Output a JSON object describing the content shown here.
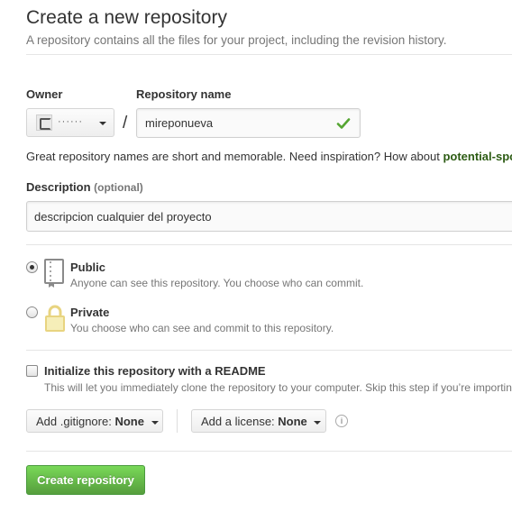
{
  "header": {
    "title": "Create a new repository",
    "subtitle": "A repository contains all the files for your project, including the revision history."
  },
  "owner": {
    "label": "Owner",
    "name": "······",
    "avatar_icon": "avatar-icon"
  },
  "repo_name": {
    "label": "Repository name",
    "value": "mireponueva",
    "status_icon": "check-icon",
    "status_color": "#55a532"
  },
  "separator": "/",
  "hint": {
    "text": "Great repository names are short and memorable. Need inspiration? How about ",
    "suggestion": "potential-spo"
  },
  "description": {
    "label": "Description",
    "optional": "(optional)",
    "value": "descripcion cualquier del proyecto"
  },
  "visibility": {
    "public": {
      "title": "Public",
      "description": "Anyone can see this repository. You choose who can commit.",
      "selected": true,
      "icon": "repo-book-icon"
    },
    "private": {
      "title": "Private",
      "description": "You choose who can see and commit to this repository.",
      "selected": false,
      "icon": "lock-icon"
    }
  },
  "readme": {
    "title": "Initialize this repository with a README",
    "description": "This will let you immediately clone the repository to your computer. Skip this step if you’re importin",
    "checked": false
  },
  "gitignore": {
    "prefix": "Add .gitignore: ",
    "value": "None"
  },
  "license": {
    "prefix": "Add a license: ",
    "value": "None"
  },
  "info_icon": "info-icon",
  "submit": {
    "label": "Create repository",
    "color": "#55a532"
  }
}
